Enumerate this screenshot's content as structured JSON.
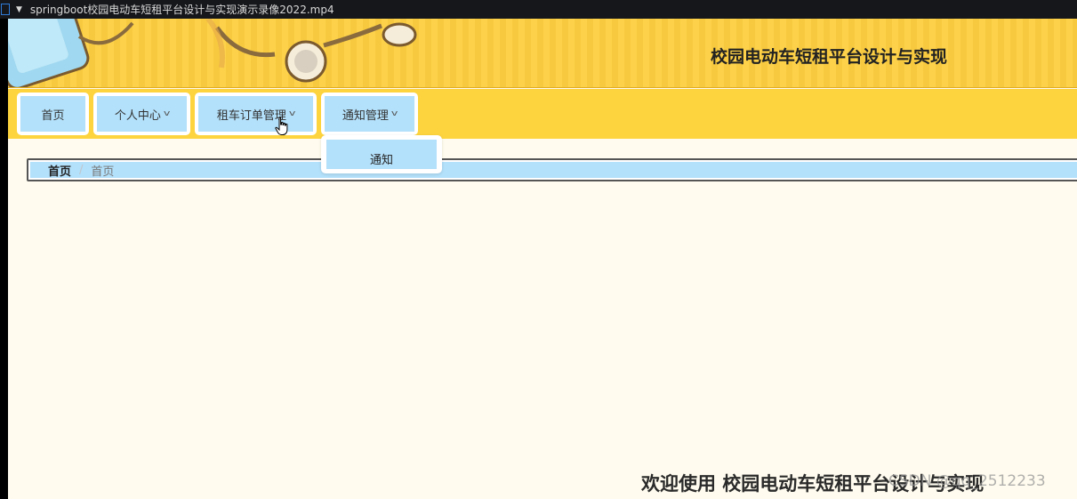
{
  "window": {
    "title": "springboot校园电动车短租平台设计与实现演示录像2022.mp4"
  },
  "header": {
    "site_title": "校园电动车短租平台设计与实现"
  },
  "nav": {
    "items": [
      {
        "label": "首页",
        "has_dropdown": false
      },
      {
        "label": "个人中心",
        "has_dropdown": true
      },
      {
        "label": "租车订单管理",
        "has_dropdown": true
      },
      {
        "label": "通知管理",
        "has_dropdown": true
      }
    ],
    "chevron_icon": "chevron-down-icon"
  },
  "dropdown": {
    "items": [
      {
        "label": "通知"
      }
    ]
  },
  "breadcrumb": {
    "home": "首页",
    "separator": "/",
    "current": "首页"
  },
  "main": {
    "welcome_text": "欢迎使用 校园电动车短租平台设计与实现"
  },
  "watermark": {
    "text": "CSDN @qq_2512233"
  },
  "colors": {
    "header_yellow": "#fdd24a",
    "nav_item_blue": "#b3e0fa",
    "page_background": "#fffbee"
  }
}
